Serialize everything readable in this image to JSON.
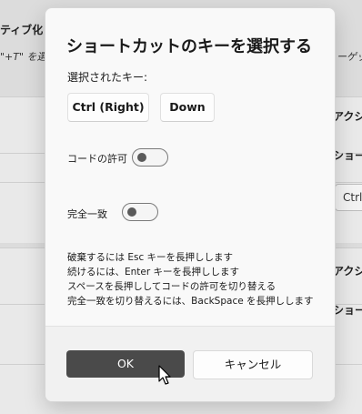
{
  "background": {
    "header_text": "ティブ化",
    "hint_text": "\"+T\" を選",
    "hint_text_right": "ーゲッ",
    "side_labels": [
      "アクシ",
      "ショー",
      "アクシ",
      "ショー"
    ],
    "field_text": "Ctrl"
  },
  "dialog": {
    "title": "ショートカットのキーを選択する",
    "selected_keys_label": "選択されたキー:",
    "keys": [
      "Ctrl (Right)",
      "Down"
    ],
    "chord_label": "コードの許可",
    "chord_enabled": false,
    "exact_match_label": "完全一致",
    "exact_match_enabled": false,
    "instructions": [
      "破棄するには Esc キーを長押しします",
      "続けるには、Enter キーを長押しします",
      "スペースを長押ししてコードの許可を切り替える",
      "完全一致を切り替えるには、BackSpace を長押しします"
    ],
    "ok_label": "OK",
    "cancel_label": "キャンセル"
  },
  "colors": {
    "primary_button": "#4a4a4a",
    "dialog_bg": "#f9f9f9",
    "footer_bg": "#f1f1f1"
  }
}
